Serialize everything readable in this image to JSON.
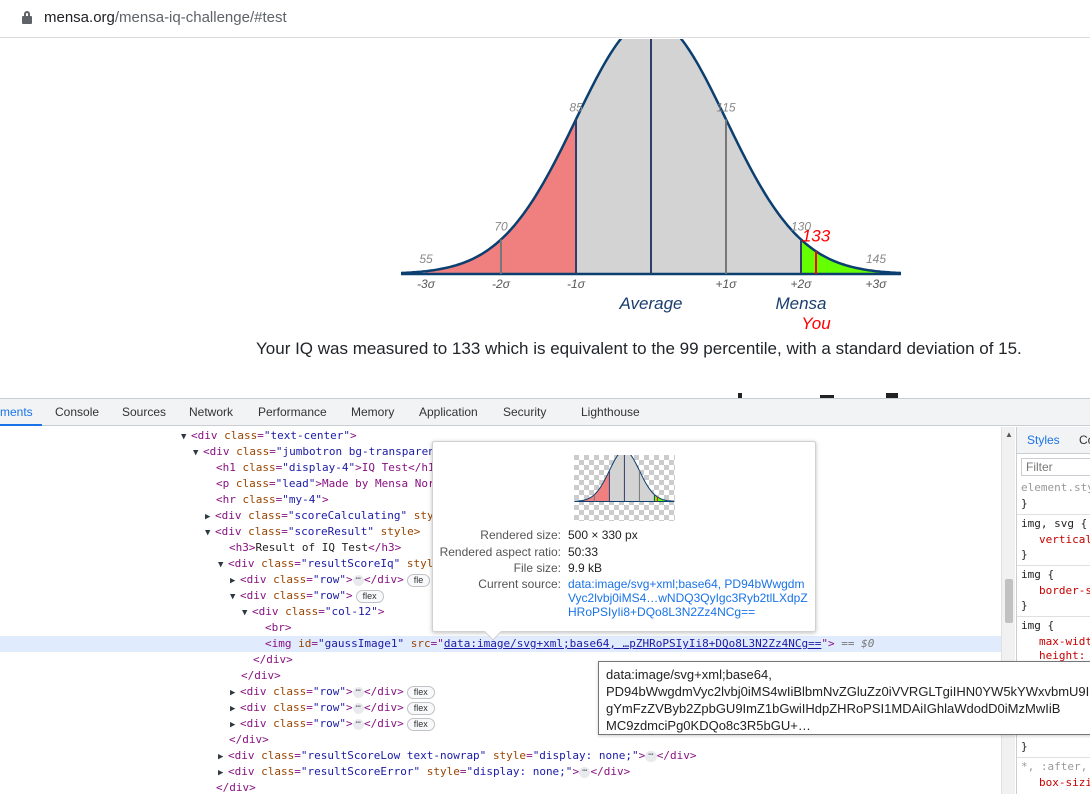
{
  "browser": {
    "url_domain": "mensa.org",
    "url_path": "/mensa-iq-challenge/#test"
  },
  "chart_data": {
    "type": "area",
    "title": "",
    "scores": {
      "s55": "55",
      "s70": "70",
      "s85": "85",
      "s115": "115",
      "s130": "130",
      "s145": "145"
    },
    "sigma_labels": [
      "-3σ",
      "-2σ",
      "-1σ",
      "+1σ",
      "+2σ",
      "+3σ"
    ],
    "annotations": {
      "average": "Average",
      "mensa": "Mensa",
      "you": "You",
      "user_score": "133"
    },
    "mean": 100,
    "sd": 15,
    "user_score": 133,
    "regions": [
      {
        "name": "below average",
        "from": 55,
        "to": 85,
        "color": "#f08080"
      },
      {
        "name": "average",
        "from": 85,
        "to": 130,
        "color": "#d3d3d3"
      },
      {
        "name": "mensa",
        "from": 130,
        "to": 150,
        "color": "#66ff00"
      }
    ],
    "colors": {
      "curve": "#0b3f70",
      "line": "#2d3e6b",
      "you": "#ff0000",
      "label": "#888888"
    }
  },
  "page": {
    "result_text": "Your IQ was measured to 133 which is equivalent to the 99 percentile, with a standard deviation of 15."
  },
  "devtools": {
    "tabs": {
      "elements": "ments",
      "console": "Console",
      "sources": "Sources",
      "network": "Network",
      "performance": "Performance",
      "memory": "Memory",
      "application": "Application",
      "security": "Security",
      "lighthouse": "Lighthouse"
    },
    "dom": {
      "l1_tag": "<div ",
      "l1_an": "class",
      "l1_av": "\"text-center\"",
      "l1_end": ">",
      "l2_tag": "<div ",
      "l2_an": "class",
      "l2_av": "\"jumbotron bg-transparen",
      "l3_tag": "<h1 ",
      "l3_an": "class",
      "l3_av": "\"display-4\"",
      "l3_rest": ">IQ Test</h1",
      "l4_tag": "<p ",
      "l4_an": "class",
      "l4_av": "\"lead\"",
      "l4_rest": ">Made by Mensa Nor",
      "l5_tag": "<hr ",
      "l5_an": "class",
      "l5_av": "\"my-4\"",
      "l5_end": ">",
      "l6_tag": "<div ",
      "l6_an": "class",
      "l6_av": "\"scoreCalculating\"",
      "l6_rest": " sty",
      "l7_tag": "<div ",
      "l7_an": "class",
      "l7_av": "\"scoreResult\"",
      "l7_rest": " style>",
      "l8_tag": "<h3>",
      "l8_txt": "Result of IQ Test",
      "l8_end": "</h3>",
      "l9_tag": "<div ",
      "l9_an": "class",
      "l9_av": "\"resultScoreIq\"",
      "l9_rest": " styl",
      "l10_tag": "<div ",
      "l10_an": "class",
      "l10_av": "\"row\"",
      "l10_end": ">",
      "l10_close": "</div>",
      "l10_badge": "fle",
      "l11_tag": "<div ",
      "l11_an": "class",
      "l11_av": "\"row\"",
      "l11_end": ">",
      "l11_badge": "flex",
      "l12_tag": "<div ",
      "l12_an": "class",
      "l12_av": "\"col-12\"",
      "l12_end": ">",
      "l13_tag": "<br>",
      "l14_tag": "<img ",
      "l14_an1": "id",
      "l14_av1": "\"gaussImage1\"",
      "l14_an2": "src",
      "l14_q": "=\"",
      "l14_link": "data:image/svg+xml;base64, …pZHRoPSIyIi8+DQo8L3N2Zz4NCg==",
      "l14_end": "\">",
      "l14_eq": " == $0",
      "l15_tag": "</div>",
      "l16_tag": "</div>",
      "l17_tag": "<div ",
      "l17_an": "class",
      "l17_av": "\"row\"",
      "l17_end": ">",
      "l17_close": "</div>",
      "l17_badge": "flex",
      "l18_tag": "<div ",
      "l18_an": "class",
      "l18_av": "\"row\"",
      "l18_end": ">",
      "l18_close": "</div>",
      "l18_badge": "flex",
      "l19_tag": "<div ",
      "l19_an": "class",
      "l19_av": "\"row\"",
      "l19_end": ">",
      "l19_close": "</div>",
      "l19_badge": "flex",
      "l20_tag": "</div>",
      "l21_tag": "<div ",
      "l21_an1": "class",
      "l21_av1": "\"resultScoreLow text-nowrap\"",
      "l21_an2": "style",
      "l21_av2": "\"display: none;\"",
      "l21_end": ">",
      "l21_close": "</div>",
      "l22_tag": "<div ",
      "l22_an1": "class",
      "l22_av1": "\"resultScoreError\"",
      "l22_an2": "style",
      "l22_av2": "\"display: none;\"",
      "l22_end": ">",
      "l22_close": "</div>",
      "l23_tag": "</div>",
      "ellipsis": "⋯"
    },
    "tooltip": {
      "rendered_size_label": "Rendered size:",
      "rendered_size_value": "500 × 330 px",
      "aspect_label": "Rendered aspect ratio:",
      "aspect_value": "50:33",
      "file_size_label": "File size:",
      "file_size_value": "9.9 kB",
      "source_label": "Current source:",
      "source_line1": "data:image/svg+xml;base64, PD94bWwgdm",
      "source_line2": "Vyc2lvbj0iMS4…wNDQ3QyIgc3Ryb2tlLXdpZ",
      "source_line3": "HRoPSIyIi8+DQo8L3N2Zz4NCg=="
    },
    "data_tooltip": {
      "line1": "data:image/svg+xml;base64,",
      "line2": "PD94bWwgdmVyc2lvbj0iMS4wIiBlbmNvZGluZz0iVVRGLTgiIHN0YW5kYWxvbmU9Im5vIj8+",
      "line3": "gYmFzZVByb2ZpbGU9ImZ1bGwiIHdpZHRoPSI1MDAiIGhlaWdodD0iMzMwIiB",
      "line4": "MC9zdmciPg0KDQo8c3R5bGU+…"
    },
    "styles": {
      "tab_styles": "Styles",
      "tab_computed": "Co",
      "filter_placeholder": "Filter",
      "element_style": "element.sty",
      "close_brace": "}",
      "rule1": "img, svg {",
      "rule1_prop": "vertical",
      "rule2": "img {",
      "rule2_prop": "border-s",
      "rule3": "img {",
      "rule3_prop1": "max-widt",
      "rule3_prop2": "height:",
      "rule4": "*, :after,",
      "rule4_prop": "box-sizi"
    }
  }
}
